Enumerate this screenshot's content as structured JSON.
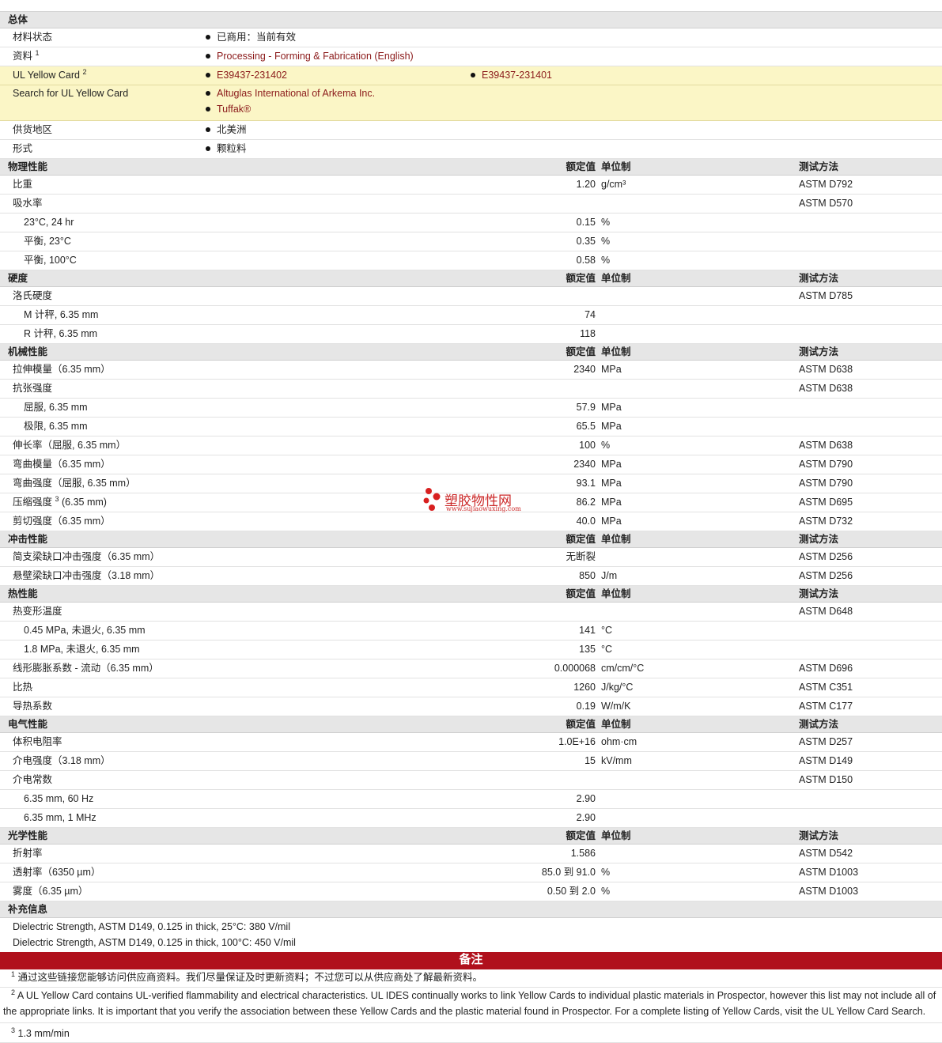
{
  "general": {
    "header": "总体",
    "material_status": {
      "label": "材料状态",
      "value": "已商用：当前有效"
    },
    "documents": {
      "label": "资料",
      "sup": "1",
      "link": "Processing - Forming & Fabrication (English)"
    },
    "yellow_card": {
      "label": "UL Yellow Card",
      "sup": "2",
      "link1": "E39437-231402",
      "link2": "E39437-231401"
    },
    "yellow_card_search": {
      "label": "Search for UL Yellow Card",
      "link1": "Altuglas International of Arkema Inc.",
      "link2": "Tuffak®"
    },
    "region": {
      "label": "供货地区",
      "value": "北美洲"
    },
    "form": {
      "label": "形式",
      "value": "颗粒料"
    }
  },
  "column_headers": {
    "value": "额定值",
    "unit": "单位制",
    "test": "测试方法"
  },
  "sections": {
    "physical": {
      "title": "物理性能",
      "rows": [
        {
          "label": "比重",
          "value": "1.20",
          "unit": "g/cm³",
          "test": "ASTM D792"
        },
        {
          "label": "吸水率",
          "value": "",
          "unit": "",
          "test": "ASTM D570"
        },
        {
          "label": "23°C, 24 hr",
          "value": "0.15",
          "unit": "%",
          "test": ""
        },
        {
          "label": "平衡, 23°C",
          "value": "0.35",
          "unit": "%",
          "test": ""
        },
        {
          "label": "平衡, 100°C",
          "value": "0.58",
          "unit": "%",
          "test": ""
        }
      ]
    },
    "hardness": {
      "title": "硬度",
      "rows": [
        {
          "label": "洛氏硬度",
          "value": "",
          "unit": "",
          "test": "ASTM D785"
        },
        {
          "label": "M 计秤, 6.35 mm",
          "value": "74",
          "unit": "",
          "test": ""
        },
        {
          "label": "R 计秤, 6.35 mm",
          "value": "118",
          "unit": "",
          "test": ""
        }
      ]
    },
    "mechanical": {
      "title": "机械性能",
      "rows": [
        {
          "label": "拉伸模量（6.35 mm）",
          "value": "2340",
          "unit": "MPa",
          "test": "ASTM D638"
        },
        {
          "label": "抗张强度",
          "value": "",
          "unit": "",
          "test": "ASTM D638"
        },
        {
          "label": "屈服, 6.35 mm",
          "value": "57.9",
          "unit": "MPa",
          "test": ""
        },
        {
          "label": "极限, 6.35 mm",
          "value": "65.5",
          "unit": "MPa",
          "test": ""
        },
        {
          "label": "伸长率（屈服, 6.35 mm）",
          "value": "100",
          "unit": "%",
          "test": "ASTM D638"
        },
        {
          "label": "弯曲模量（6.35 mm）",
          "value": "2340",
          "unit": "MPa",
          "test": "ASTM D790"
        },
        {
          "label": "弯曲强度（屈服, 6.35 mm）",
          "value": "93.1",
          "unit": "MPa",
          "test": "ASTM D790"
        },
        {
          "label": "压缩强度",
          "sup": "3",
          "label_suffix": "(6.35 mm)",
          "value": "86.2",
          "unit": "MPa",
          "test": "ASTM D695"
        },
        {
          "label": "剪切强度（6.35 mm）",
          "value": "40.0",
          "unit": "MPa",
          "test": "ASTM D732"
        }
      ]
    },
    "impact": {
      "title": "冲击性能",
      "rows": [
        {
          "label": "简支梁缺口冲击强度（6.35 mm）",
          "value": "无断裂",
          "unit": "",
          "test": "ASTM D256"
        },
        {
          "label": "悬壁梁缺口冲击强度（3.18 mm）",
          "value": "850",
          "unit": "J/m",
          "test": "ASTM D256"
        }
      ]
    },
    "thermal": {
      "title": "热性能",
      "rows": [
        {
          "label": "热变形温度",
          "value": "",
          "unit": "",
          "test": "ASTM D648"
        },
        {
          "label": "0.45 MPa, 未退火, 6.35 mm",
          "value": "141",
          "unit": "°C",
          "test": ""
        },
        {
          "label": "1.8 MPa, 未退火, 6.35 mm",
          "value": "135",
          "unit": "°C",
          "test": ""
        },
        {
          "label": "线形膨胀系数 - 流动（6.35 mm）",
          "value": "0.000068",
          "unit": "cm/cm/°C",
          "test": "ASTM D696"
        },
        {
          "label": "比热",
          "value": "1260",
          "unit": "J/kg/°C",
          "test": "ASTM C351"
        },
        {
          "label": "导热系数",
          "value": "0.19",
          "unit": "W/m/K",
          "test": "ASTM C177"
        }
      ]
    },
    "electrical": {
      "title": "电气性能",
      "rows": [
        {
          "label": "体积电阻率",
          "value": "1.0E+16",
          "unit": "ohm·cm",
          "test": "ASTM D257"
        },
        {
          "label": "介电强度（3.18 mm）",
          "value": "15",
          "unit": "kV/mm",
          "test": "ASTM D149"
        },
        {
          "label": "介电常数",
          "value": "",
          "unit": "",
          "test": "ASTM D150"
        },
        {
          "label": "6.35 mm, 60 Hz",
          "value": "2.90",
          "unit": "",
          "test": ""
        },
        {
          "label": "6.35 mm, 1 MHz",
          "value": "2.90",
          "unit": "",
          "test": ""
        }
      ]
    },
    "optical": {
      "title": "光学性能",
      "rows": [
        {
          "label": "折射率",
          "value": "1.586",
          "unit": "",
          "test": "ASTM D542"
        },
        {
          "label": "透射率（6350 µm）",
          "value": "85.0 到  91.0",
          "unit": "%",
          "test": "ASTM D1003"
        },
        {
          "label": "雾度（6.35 µm）",
          "value": "0.50 到  2.0",
          "unit": "%",
          "test": "ASTM D1003"
        }
      ]
    }
  },
  "supplemental": {
    "title": "补充信息",
    "lines": [
      "Dielectric Strength, ASTM D149, 0.125 in thick, 25°C: 380 V/mil",
      "Dielectric Strength, ASTM D149, 0.125 in thick, 100°C: 450 V/mil"
    ]
  },
  "notes": {
    "title": "备注",
    "n1": {
      "sup": "1",
      "text": "通过这些链接您能够访问供应商资料。我们尽量保证及时更新资料；不过您可以从供应商处了解最新资料。"
    },
    "n2": {
      "sup": "2",
      "line1": "A UL Yellow Card contains UL-verified flammability and electrical characteristics. UL IDES continually works to link Yellow Cards to individual plastic materials in Prospector, however this list may not include all of",
      "line2": "the appropriate links. It is important that you verify the association between these Yellow Cards and the plastic material found in Prospector. For a complete listing of Yellow Cards, visit the UL Yellow Card Search."
    },
    "n3": {
      "sup": "3",
      "text": "1.3 mm/min"
    }
  },
  "watermark": {
    "main": "塑胶物性网",
    "sub": "www.sujiaowuxing.com",
    "color": "#cc2a2a"
  },
  "colors": {
    "link": "#8b1a1a",
    "yellow_row": "#fbf6c6",
    "header_row": "#e6e6e6",
    "notes_bar": "#b0101c"
  }
}
